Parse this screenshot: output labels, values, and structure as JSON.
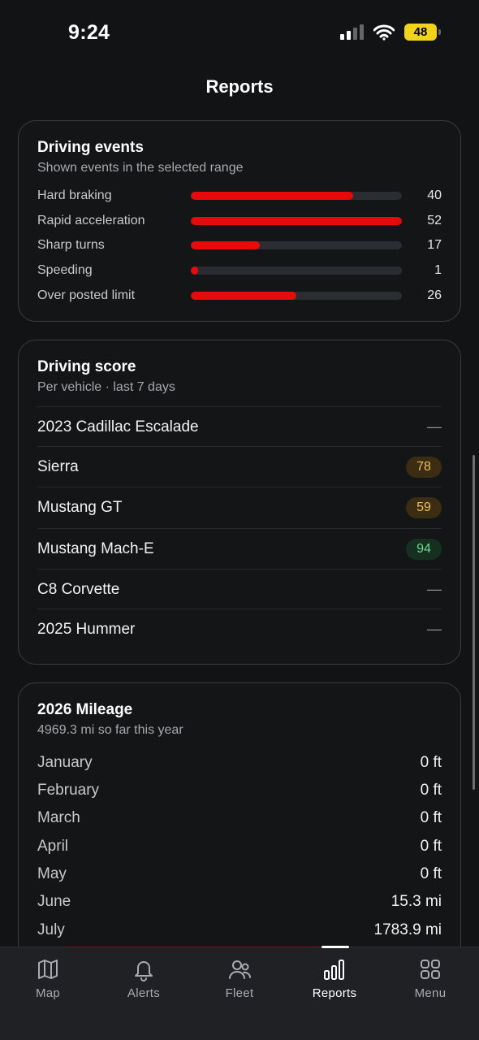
{
  "status": {
    "time": "9:24",
    "battery": "48"
  },
  "title": "Reports",
  "events": {
    "title": "Driving events",
    "subtitle": "Shown events in the selected range",
    "max": 52,
    "items": [
      {
        "label": "Hard braking",
        "value": "40"
      },
      {
        "label": "Rapid acceleration",
        "value": "52"
      },
      {
        "label": "Sharp turns",
        "value": "17"
      },
      {
        "label": "Speeding",
        "value": "1"
      },
      {
        "label": "Over posted limit",
        "value": "26"
      }
    ]
  },
  "score": {
    "title": "Driving score",
    "subtitle": "Per vehicle · last 7 days",
    "vehicles": [
      {
        "name": "2023 Cadillac Escalade",
        "score": "—",
        "tone": "none"
      },
      {
        "name": "Sierra",
        "score": "78",
        "tone": "amber"
      },
      {
        "name": "Mustang GT",
        "score": "59",
        "tone": "amber"
      },
      {
        "name": "Mustang Mach-E",
        "score": "94",
        "tone": "green"
      },
      {
        "name": "C8 Corvette",
        "score": "—",
        "tone": "none"
      },
      {
        "name": "2025 Hummer",
        "score": "—",
        "tone": "none"
      }
    ]
  },
  "mileage": {
    "title": "2026 Mileage",
    "subtitle": "4969.3 mi so far this year",
    "months": [
      {
        "month": "January",
        "value": "0 ft"
      },
      {
        "month": "February",
        "value": "0 ft"
      },
      {
        "month": "March",
        "value": "0 ft"
      },
      {
        "month": "April",
        "value": "0 ft"
      },
      {
        "month": "May",
        "value": "0 ft"
      },
      {
        "month": "June",
        "value": "15.3 mi"
      },
      {
        "month": "July",
        "value": "1783.9 mi"
      }
    ]
  },
  "tabs": [
    {
      "label": "Map",
      "icon": "map-icon",
      "active": false
    },
    {
      "label": "Alerts",
      "icon": "bell-icon",
      "active": false
    },
    {
      "label": "Fleet",
      "icon": "people-icon",
      "active": false
    },
    {
      "label": "Reports",
      "icon": "bar-chart-icon",
      "active": true
    },
    {
      "label": "Menu",
      "icon": "grid-icon",
      "active": false
    }
  ],
  "colors": {
    "accent": "#e8090b",
    "background": "#111315",
    "amber": "#f3bf5a",
    "green": "#6ed98d"
  }
}
